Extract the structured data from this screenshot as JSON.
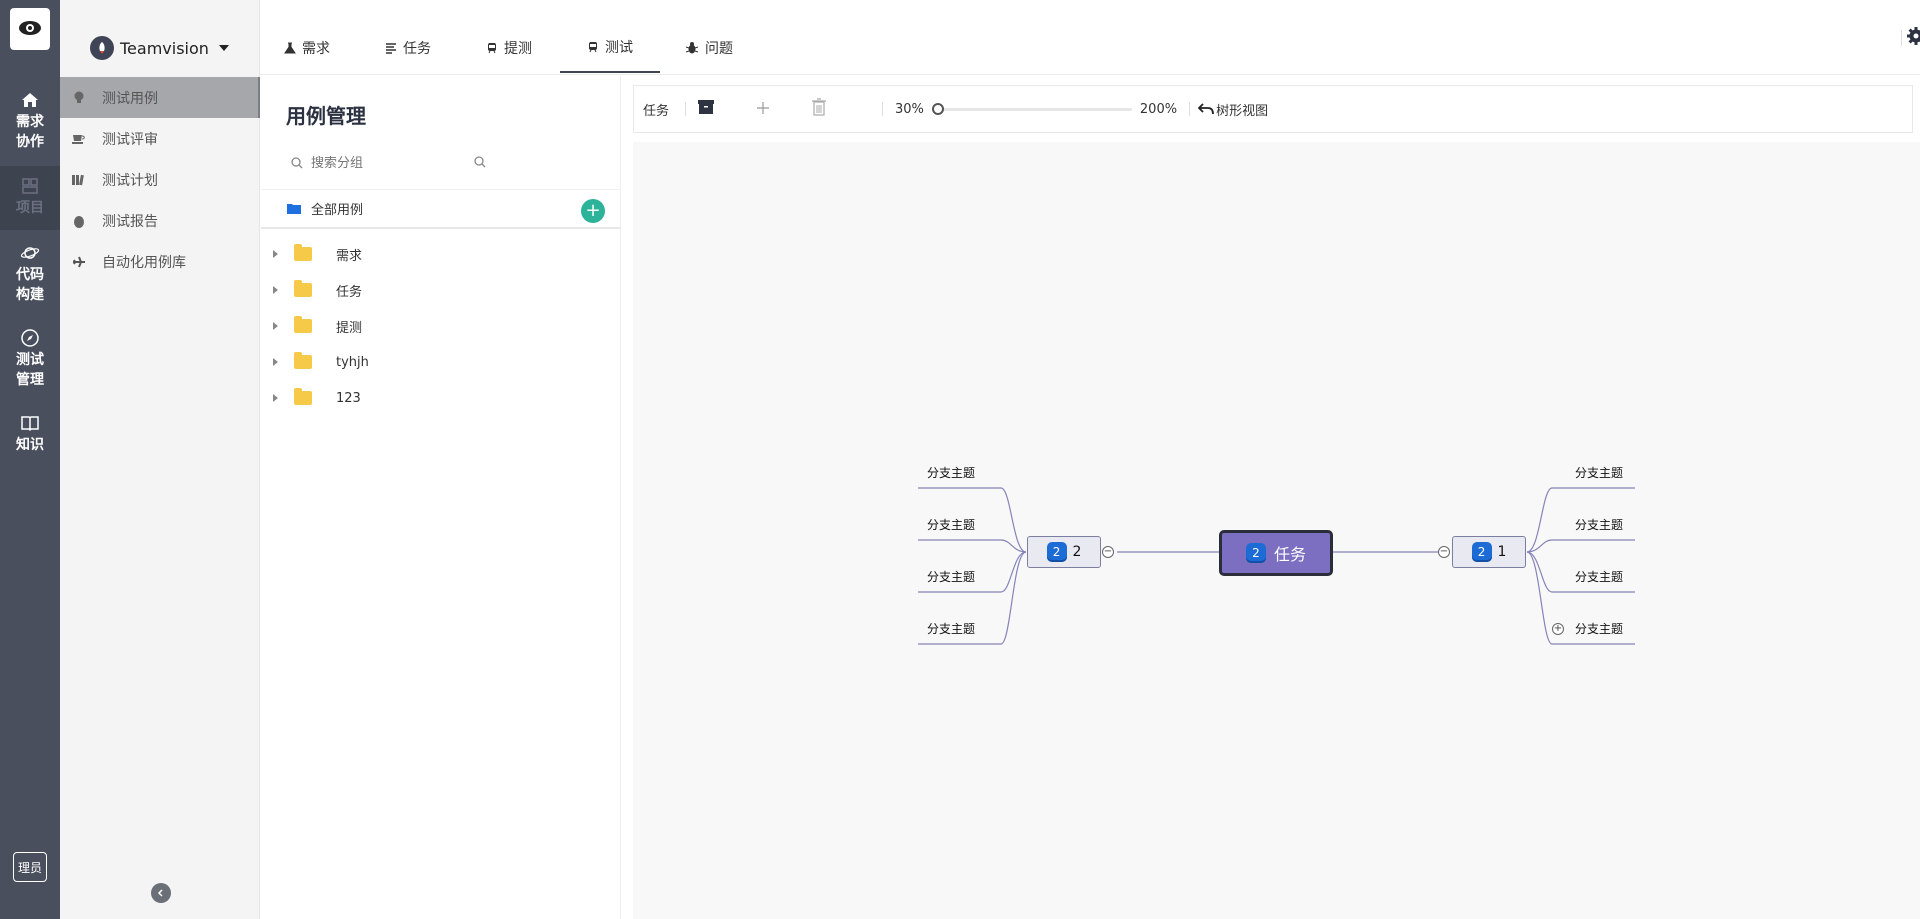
{
  "rail": {
    "items": [
      {
        "label_top": "需求",
        "label_bottom": "协作",
        "icon": "home-icon"
      },
      {
        "label_top": "项目",
        "label_bottom": "",
        "icon": "grid-icon"
      },
      {
        "label_top": "代码",
        "label_bottom": "构建",
        "icon": "planet-icon"
      },
      {
        "label_top": "测试",
        "label_bottom": "管理",
        "icon": "compass-icon"
      },
      {
        "label_top": "知识",
        "label_bottom": "",
        "icon": "book-icon"
      }
    ],
    "admin_label": "理员"
  },
  "project": {
    "name": "Teamvision"
  },
  "subnav": {
    "items": [
      {
        "label": "测试用例",
        "icon": "bulb-icon",
        "active": true
      },
      {
        "label": "测试评审",
        "icon": "cup-icon"
      },
      {
        "label": "测试计划",
        "icon": "books-icon"
      },
      {
        "label": "测试报告",
        "icon": "drop-icon"
      },
      {
        "label": "自动化用例库",
        "icon": "plane-icon"
      }
    ]
  },
  "tabs": [
    {
      "label": "需求",
      "icon": "flask-icon"
    },
    {
      "label": "任务",
      "icon": "list-icon"
    },
    {
      "label": "提测",
      "icon": "train-icon"
    },
    {
      "label": "测试",
      "icon": "train-icon",
      "active": true
    },
    {
      "label": "问题",
      "icon": "bug-icon"
    }
  ],
  "case_panel": {
    "title": "用例管理",
    "search_placeholder": "搜索分组",
    "all_cases": "全部用例",
    "folders": [
      "需求",
      "任务",
      "提测",
      "tyhjh",
      "123"
    ]
  },
  "toolbar": {
    "node_label": "任务",
    "zoom_min": "30%",
    "zoom_max": "200%",
    "zoom_value": 0.3,
    "tree_view": "树形视图"
  },
  "mindmap": {
    "root": {
      "label": "任务",
      "badge": "2"
    },
    "left": {
      "label": "2",
      "badge": "2",
      "children": [
        "分支主题",
        "分支主题",
        "分支主题",
        "分支主题"
      ]
    },
    "right": {
      "label": "1",
      "badge": "2",
      "children": [
        "分支主题",
        "分支主题",
        "分支主题",
        "分支主题"
      ]
    }
  },
  "colors": {
    "rail": "#4a4f5e",
    "root_node": "#7c6fc1",
    "add_button": "#2db39a",
    "badge": "#1d6cd6",
    "folder": "#f7c948"
  }
}
